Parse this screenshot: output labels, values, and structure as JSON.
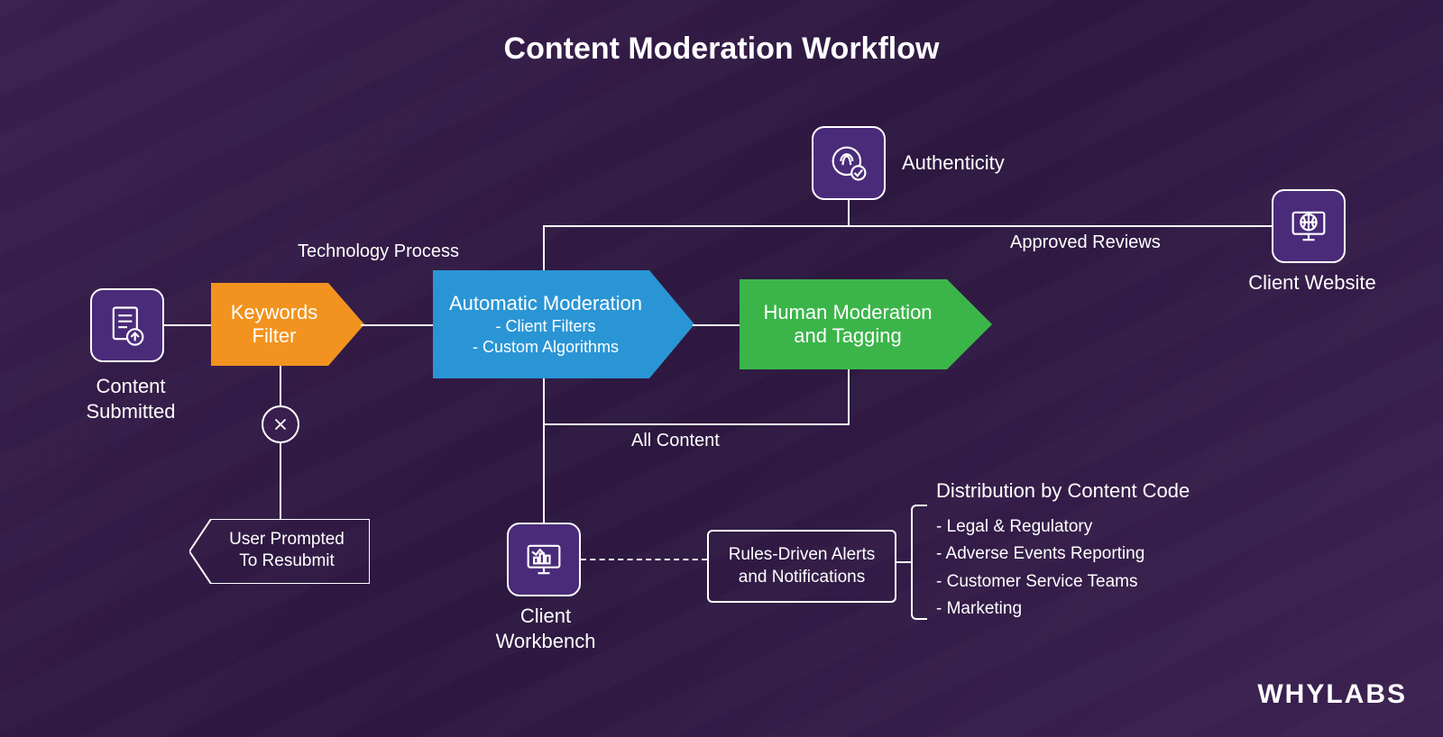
{
  "title": "Content Moderation Workflow",
  "nodes": {
    "content_submitted": "Content\nSubmitted",
    "keywords_filter": "Keywords\nFilter",
    "technology_process": "Technology Process",
    "auto_mod_title": "Automatic Moderation",
    "auto_mod_sub1": "- Client Filters",
    "auto_mod_sub2": "- Custom Algorithms",
    "human_mod": "Human Moderation\nand Tagging",
    "authenticity": "Authenticity",
    "approved_reviews": "Approved Reviews",
    "client_website": "Client\nWebsite",
    "user_resubmit": "User Prompted\nTo Resubmit",
    "all_content": "All Content",
    "client_workbench": "Client\nWorkbench",
    "rules_box": "Rules-Driven Alerts\nand Notifications",
    "dist_heading": "Distribution by Content Code",
    "dist_items": [
      "- Legal & Regulatory",
      "- Adverse Events Reporting",
      "- Customer Service Teams",
      "- Marketing"
    ]
  },
  "colors": {
    "orange": "#f2931f",
    "blue": "#2a95d5",
    "green": "#3bb54a",
    "tile": "#4a2b7a"
  },
  "brand": "WHYLABS"
}
